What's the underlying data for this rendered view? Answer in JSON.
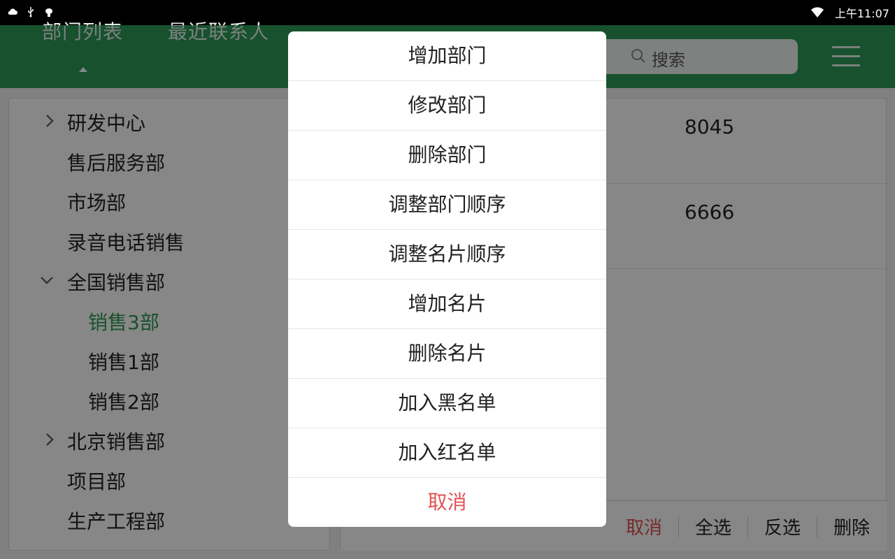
{
  "status_bar": {
    "left_icons": [
      "cloud-icon",
      "usb-icon",
      "android-debug-icon"
    ],
    "time": "上午11:07",
    "wifi_icon": "wifi-icon"
  },
  "app_bar": {
    "tabs": [
      {
        "label": "部门列表",
        "selected": true
      },
      {
        "label": "最近联系人",
        "selected": false
      }
    ],
    "search": {
      "placeholder": "搜索"
    },
    "menu_icon": "hamburger-menu-icon",
    "color": "#2c9a58"
  },
  "department_tree": [
    {
      "label": "研发中心",
      "expander": "chevron-right-icon"
    },
    {
      "label": "售后服务部"
    },
    {
      "label": "市场部"
    },
    {
      "label": "录音电话销售"
    },
    {
      "label": "全国销售部",
      "expander": "chevron-down-icon"
    },
    {
      "label": "销售3部",
      "active": true
    },
    {
      "label": "销售1部"
    },
    {
      "label": "销售2部"
    },
    {
      "label": "北京销售部",
      "expander": "chevron-right-icon"
    },
    {
      "label": "项目部"
    },
    {
      "label": "生产工程部"
    }
  ],
  "contact_rows": [
    {
      "number": "8045"
    },
    {
      "number": "6666"
    }
  ],
  "bottom_actions": [
    {
      "label": "取消",
      "color": "#e05252"
    },
    {
      "label": "全选"
    },
    {
      "label": "反选"
    },
    {
      "label": "删除"
    }
  ],
  "dialog": {
    "items": [
      {
        "label": "增加部门"
      },
      {
        "label": "修改部门"
      },
      {
        "label": "删除部门"
      },
      {
        "label": "调整部门顺序"
      },
      {
        "label": "调整名片顺序"
      },
      {
        "label": "增加名片"
      },
      {
        "label": "删除名片"
      },
      {
        "label": "加入黑名单"
      },
      {
        "label": "加入红名单"
      },
      {
        "label": "取消",
        "color": "#e05252"
      }
    ]
  }
}
